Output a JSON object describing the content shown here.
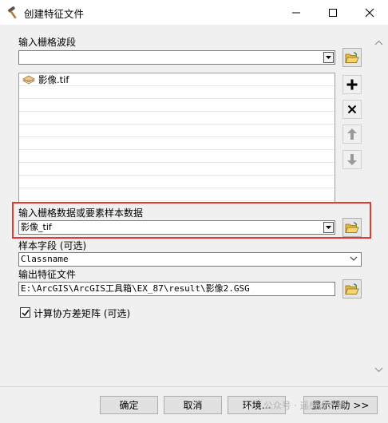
{
  "window": {
    "title": "创建特征文件",
    "minimize_glyph": "—",
    "maximize_glyph": "☐",
    "close_glyph": "✕"
  },
  "raster_bands": {
    "label": "输入栅格波段",
    "value": "",
    "items": [
      {
        "name": "影像.tif",
        "icon": "raster-layer-icon"
      }
    ]
  },
  "samples": {
    "label": "输入栅格数据或要素样本数据",
    "value": "影像_tif"
  },
  "sample_field": {
    "label": "样本字段 (可选)",
    "value": "Classname"
  },
  "output": {
    "label": "输出特征文件",
    "value": "E:\\ArcGIS\\ArcGIS工具箱\\EX_87\\result\\影像2.GSG"
  },
  "covariance": {
    "label": "计算协方差矩阵 (可选)",
    "checked": true
  },
  "buttons": {
    "ok": "确定",
    "cancel": "取消",
    "environments": "环境...",
    "show_help": "显示帮助 >>"
  },
  "watermark": "公众号 · 遥感设计师",
  "colors": {
    "highlight": "#e53935",
    "folder": "#e8b93c"
  }
}
